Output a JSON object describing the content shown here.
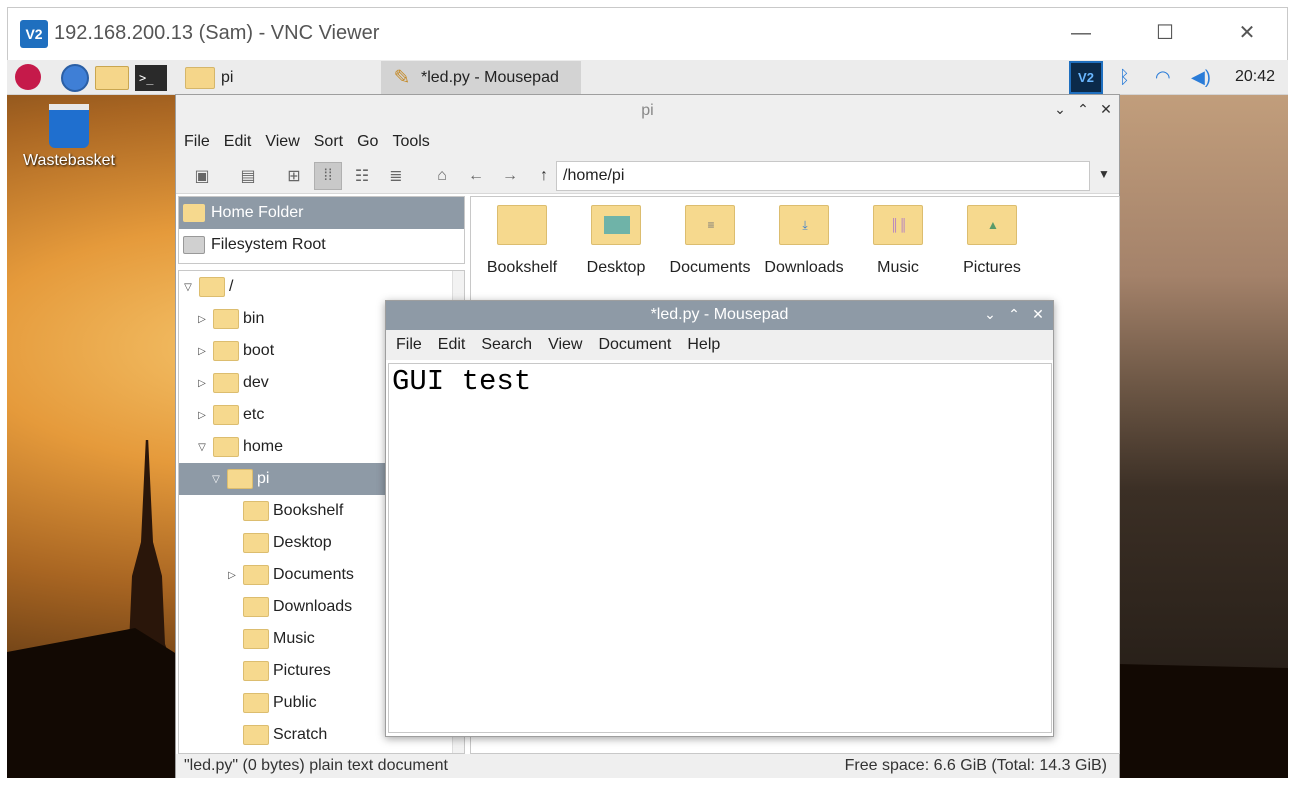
{
  "vnc": {
    "logo": "V2",
    "title": "192.168.200.13 (Sam) - VNC Viewer",
    "controls": {
      "minimize": "—",
      "maximize": "☐",
      "close": "✕"
    }
  },
  "taskbar": {
    "terminal_glyph": ">_",
    "tasks": [
      {
        "label": "pi"
      },
      {
        "label": "*led.py - Mousepad"
      }
    ],
    "tray": {
      "vnc": "V2",
      "bluetooth": "ᛒ",
      "wifi": "◠",
      "volume": "◀)"
    },
    "clock": "20:42"
  },
  "desktop": {
    "wastebasket_label": "Wastebasket"
  },
  "file_manager": {
    "title": "pi",
    "window_controls": {
      "minimize": "⌄",
      "maximize": "⌃",
      "close": "✕"
    },
    "menu": [
      "File",
      "Edit",
      "View",
      "Sort",
      "Go",
      "Tools"
    ],
    "path": "/home/pi",
    "places": [
      {
        "label": "Home Folder"
      },
      {
        "label": "Filesystem Root"
      }
    ],
    "tree": [
      {
        "label": "/",
        "expander": "▽"
      },
      {
        "label": "bin",
        "expander": "▷"
      },
      {
        "label": "boot",
        "expander": "▷"
      },
      {
        "label": "dev",
        "expander": "▷"
      },
      {
        "label": "etc",
        "expander": "▷"
      },
      {
        "label": "home",
        "expander": "▽"
      },
      {
        "label": "pi",
        "expander": "▽"
      },
      {
        "label": "Bookshelf",
        "expander": ""
      },
      {
        "label": "Desktop",
        "expander": ""
      },
      {
        "label": "Documents",
        "expander": "▷"
      },
      {
        "label": "Downloads",
        "expander": ""
      },
      {
        "label": "Music",
        "expander": ""
      },
      {
        "label": "Pictures",
        "expander": ""
      },
      {
        "label": "Public",
        "expander": ""
      },
      {
        "label": "Scratch",
        "expander": ""
      }
    ],
    "icons": [
      {
        "label": "Bookshelf"
      },
      {
        "label": "Desktop"
      },
      {
        "label": "Documents"
      },
      {
        "label": "Downloads"
      },
      {
        "label": "Music"
      },
      {
        "label": "Pictures"
      }
    ],
    "status_left": "\"led.py\" (0 bytes) plain text document",
    "status_right": "Free space: 6.6 GiB (Total: 14.3 GiB)"
  },
  "mousepad": {
    "title": "*led.py - Mousepad",
    "window_controls": {
      "minimize": "⌄",
      "maximize": "⌃",
      "close": "✕"
    },
    "menu": [
      "File",
      "Edit",
      "Search",
      "View",
      "Document",
      "Help"
    ],
    "content": "GUI test"
  }
}
